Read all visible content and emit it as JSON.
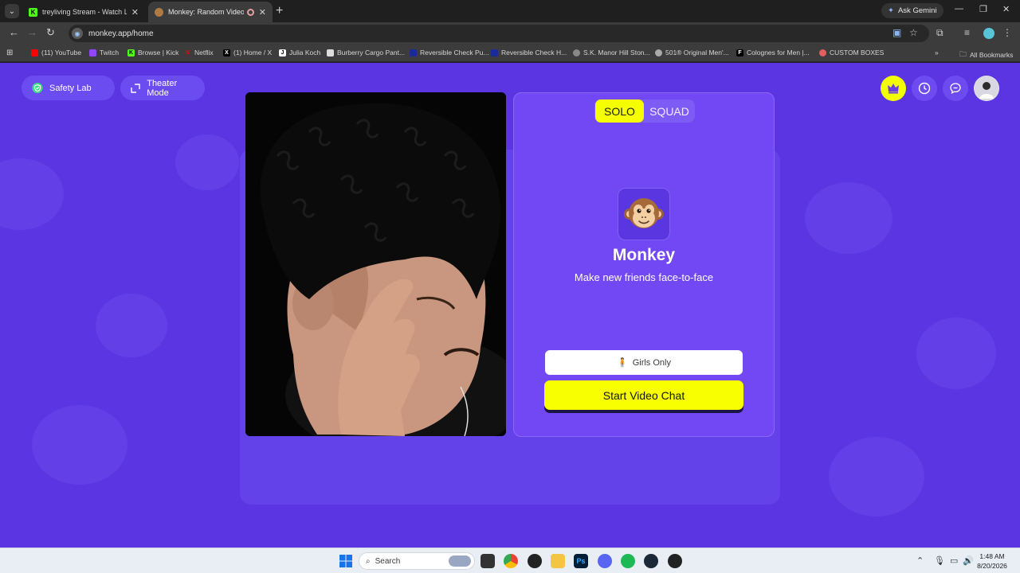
{
  "browser": {
    "tabs": [
      {
        "title": "treyliving Stream - Watch Live o",
        "active": false
      },
      {
        "title": "Monkey: Random Video Ch",
        "active": true
      }
    ],
    "ask_gemini": "Ask Gemini",
    "url": "monkey.app/home",
    "bookmarks": [
      "(11) YouTube",
      "Twitch",
      "Browse | Kick",
      "Netflix",
      "(1) Home / X",
      "Julia Koch",
      "Burberry Cargo Pant...",
      "Reversible Check Pu...",
      "Reversible Check H...",
      "S.K. Manor Hill Ston...",
      "501® Original Men'...",
      "Colognes for Men |...",
      "CUSTOM BOXES"
    ],
    "all_bookmarks": "All Bookmarks"
  },
  "page": {
    "safety_lab": "Safety Lab",
    "theater_mode": "Theater Mode",
    "mode_tabs": {
      "solo": "SOLO",
      "squad": "SQUAD",
      "selected": "SOLO"
    },
    "brand_name": "Monkey",
    "tagline": "Make new friends face-to-face",
    "girls_only": "Girls Only",
    "start_button": "Start Video Chat",
    "colors": {
      "background": "#5b35e2",
      "accent": "#f7ff00",
      "panel": "#7248f4"
    }
  },
  "taskbar": {
    "search_placeholder": "Search",
    "time": "1:48 AM",
    "date": "8/20/2026"
  }
}
